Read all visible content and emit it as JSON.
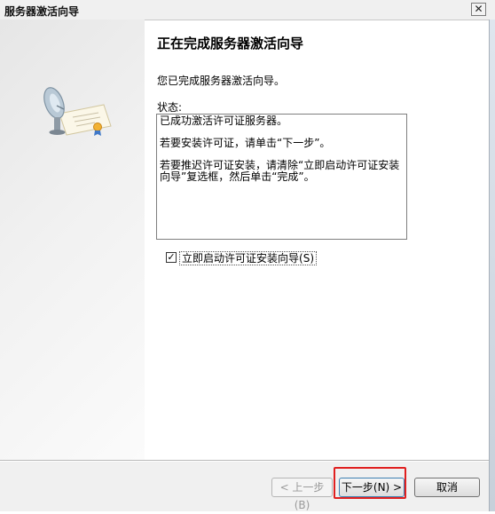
{
  "window": {
    "title": "服务器激活向导",
    "close_glyph": "✕"
  },
  "page": {
    "heading": "正在完成服务器激活向导",
    "description": "您已完成服务器激活向导。",
    "status_label": "状态:",
    "status_lines": [
      "已成功激活许可证服务器。",
      "若要安装许可证，请单击“下一步”。",
      "若要推迟许可证安装，请清除“立即启动许可证安装向导”复选框，然后单击“完成”。"
    ]
  },
  "checkbox": {
    "label": "立即启动许可证安装向导",
    "accelerator": "S",
    "checked": true,
    "check_glyph": "✓"
  },
  "buttons": {
    "back": "< 上一步(B)",
    "next": "下一步(N) >",
    "cancel": "取消"
  },
  "icons": {
    "wizard_art": "certificate-with-satellite-dish"
  },
  "colors": {
    "highlight": "#e02020",
    "default_button_border": "#3c7fb1"
  }
}
